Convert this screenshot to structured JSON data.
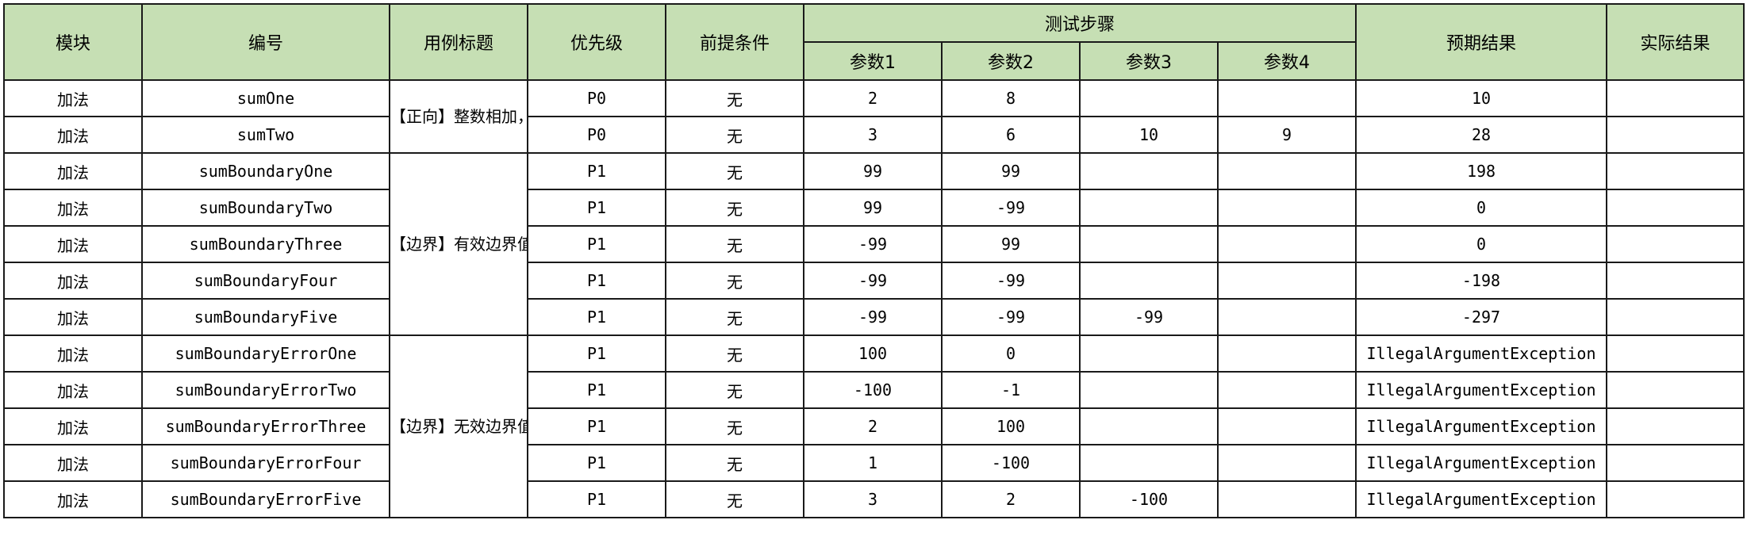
{
  "headers": {
    "module": "模块",
    "id": "编号",
    "title": "用例标题",
    "priority": "优先级",
    "precondition": "前提条件",
    "steps": "测试步骤",
    "param1": "参数1",
    "param2": "参数2",
    "param3": "参数3",
    "param4": "参数4",
    "expected": "预期结果",
    "actual": "实际结果"
  },
  "titles": [
    "【正向】整数相加，结果计算正确",
    "【边界】有效边界值相加，结果计算正确",
    "【边界】无效边界值相加，给出提示信息"
  ],
  "rows": [
    {
      "module": "加法",
      "id": "sumOne",
      "priority": "P0",
      "precondition": "无",
      "p1": "2",
      "p2": "8",
      "p3": "",
      "p4": "",
      "expected": "10",
      "actual": ""
    },
    {
      "module": "加法",
      "id": "sumTwo",
      "priority": "P0",
      "precondition": "无",
      "p1": "3",
      "p2": "6",
      "p3": "10",
      "p4": "9",
      "expected": "28",
      "actual": ""
    },
    {
      "module": "加法",
      "id": "sumBoundaryOne",
      "priority": "P1",
      "precondition": "无",
      "p1": "99",
      "p2": "99",
      "p3": "",
      "p4": "",
      "expected": "198",
      "actual": ""
    },
    {
      "module": "加法",
      "id": "sumBoundaryTwo",
      "priority": "P1",
      "precondition": "无",
      "p1": "99",
      "p2": "-99",
      "p3": "",
      "p4": "",
      "expected": "0",
      "actual": ""
    },
    {
      "module": "加法",
      "id": "sumBoundaryThree",
      "priority": "P1",
      "precondition": "无",
      "p1": "-99",
      "p2": "99",
      "p3": "",
      "p4": "",
      "expected": "0",
      "actual": ""
    },
    {
      "module": "加法",
      "id": "sumBoundaryFour",
      "priority": "P1",
      "precondition": "无",
      "p1": "-99",
      "p2": "-99",
      "p3": "",
      "p4": "",
      "expected": "-198",
      "actual": ""
    },
    {
      "module": "加法",
      "id": "sumBoundaryFive",
      "priority": "P1",
      "precondition": "无",
      "p1": "-99",
      "p2": "-99",
      "p3": "-99",
      "p4": "",
      "expected": "-297",
      "actual": ""
    },
    {
      "module": "加法",
      "id": "sumBoundaryErrorOne",
      "priority": "P1",
      "precondition": "无",
      "p1": "100",
      "p2": "0",
      "p3": "",
      "p4": "",
      "expected": "IllegalArgumentException",
      "actual": ""
    },
    {
      "module": "加法",
      "id": "sumBoundaryErrorTwo",
      "priority": "P1",
      "precondition": "无",
      "p1": "-100",
      "p2": "-1",
      "p3": "",
      "p4": "",
      "expected": "IllegalArgumentException",
      "actual": ""
    },
    {
      "module": "加法",
      "id": "sumBoundaryErrorThree",
      "priority": "P1",
      "precondition": "无",
      "p1": "2",
      "p2": "100",
      "p3": "",
      "p4": "",
      "expected": "IllegalArgumentException",
      "actual": ""
    },
    {
      "module": "加法",
      "id": "sumBoundaryErrorFour",
      "priority": "P1",
      "precondition": "无",
      "p1": "1",
      "p2": "-100",
      "p3": "",
      "p4": "",
      "expected": "IllegalArgumentException",
      "actual": ""
    },
    {
      "module": "加法",
      "id": "sumBoundaryErrorFive",
      "priority": "P1",
      "precondition": "无",
      "p1": "3",
      "p2": "2",
      "p3": "-100",
      "p4": "",
      "expected": "IllegalArgumentException",
      "actual": ""
    }
  ]
}
